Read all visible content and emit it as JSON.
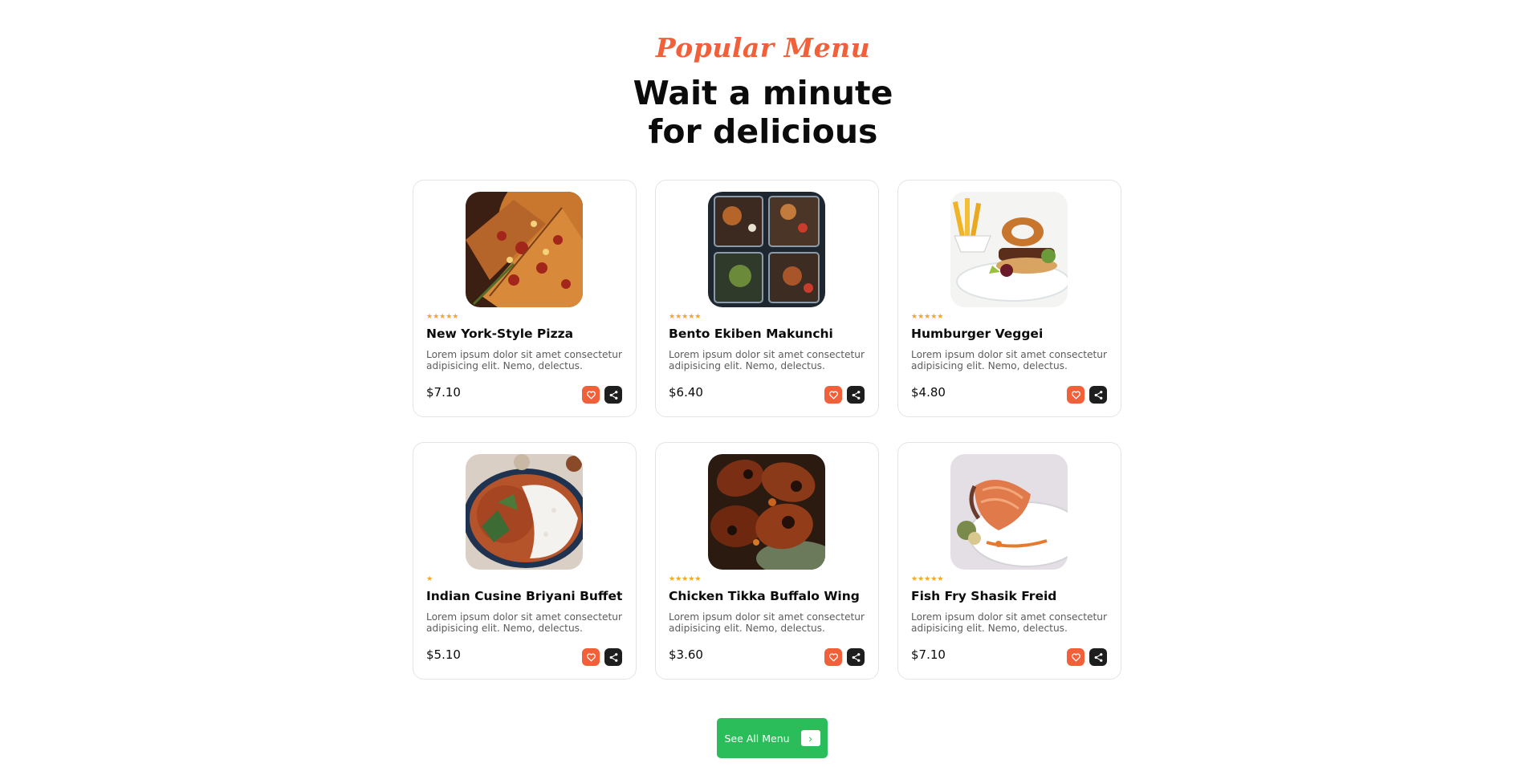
{
  "section": {
    "kicker": "Popular Menu",
    "headline_line1": "Wait a minute",
    "headline_line2": "for delicious"
  },
  "colors": {
    "accent": "#f2603a",
    "star": "#f5a623",
    "share_button": "#1e1e1e",
    "cta": "#2bbd5a"
  },
  "menu_items": [
    {
      "name": "New York-Style Pizza",
      "description": "Lorem ipsum dolor sit amet consectetur adipisicing elit. Nemo, delectus.",
      "price": "$7.10",
      "rating": 5,
      "stars": "★★★★★",
      "image_icon": "pizza-photo"
    },
    {
      "name": "Bento Ekiben Makunchi",
      "description": "Lorem ipsum dolor sit amet consectetur adipisicing elit. Nemo, delectus.",
      "price": "$6.40",
      "rating": 5,
      "stars": "★★★★★",
      "image_icon": "bento-photo"
    },
    {
      "name": "Humburger Veggei",
      "description": "Lorem ipsum dolor sit amet consectetur adipisicing elit. Nemo, delectus.",
      "price": "$4.80",
      "rating": 5,
      "stars": "★★★★★",
      "image_icon": "burger-photo"
    },
    {
      "name": "Indian Cusine Briyani Buffet",
      "description": "Lorem ipsum dolor sit amet consectetur adipisicing elit. Nemo, delectus.",
      "price": "$5.10",
      "rating": 1,
      "stars": "★",
      "image_icon": "curry-rice-photo"
    },
    {
      "name": "Chicken Tikka Buffalo Wing",
      "description": "Lorem ipsum dolor sit amet consectetur adipisicing elit. Nemo, delectus.",
      "price": "$3.60",
      "rating": 5,
      "stars": "★★★★★",
      "image_icon": "chicken-wings-photo"
    },
    {
      "name": "Fish Fry Shasik Freid",
      "description": "Lorem ipsum dolor sit amet consectetur adipisicing elit. Nemo, delectus.",
      "price": "$7.10",
      "rating": 5,
      "stars": "★★★★★",
      "image_icon": "salmon-photo"
    }
  ],
  "icons": {
    "favorite": "heart-icon",
    "share": "share-icon",
    "cta_arrow": "chevron-right-icon"
  },
  "cta": {
    "label": "See All Menu",
    "arrow": "›"
  }
}
